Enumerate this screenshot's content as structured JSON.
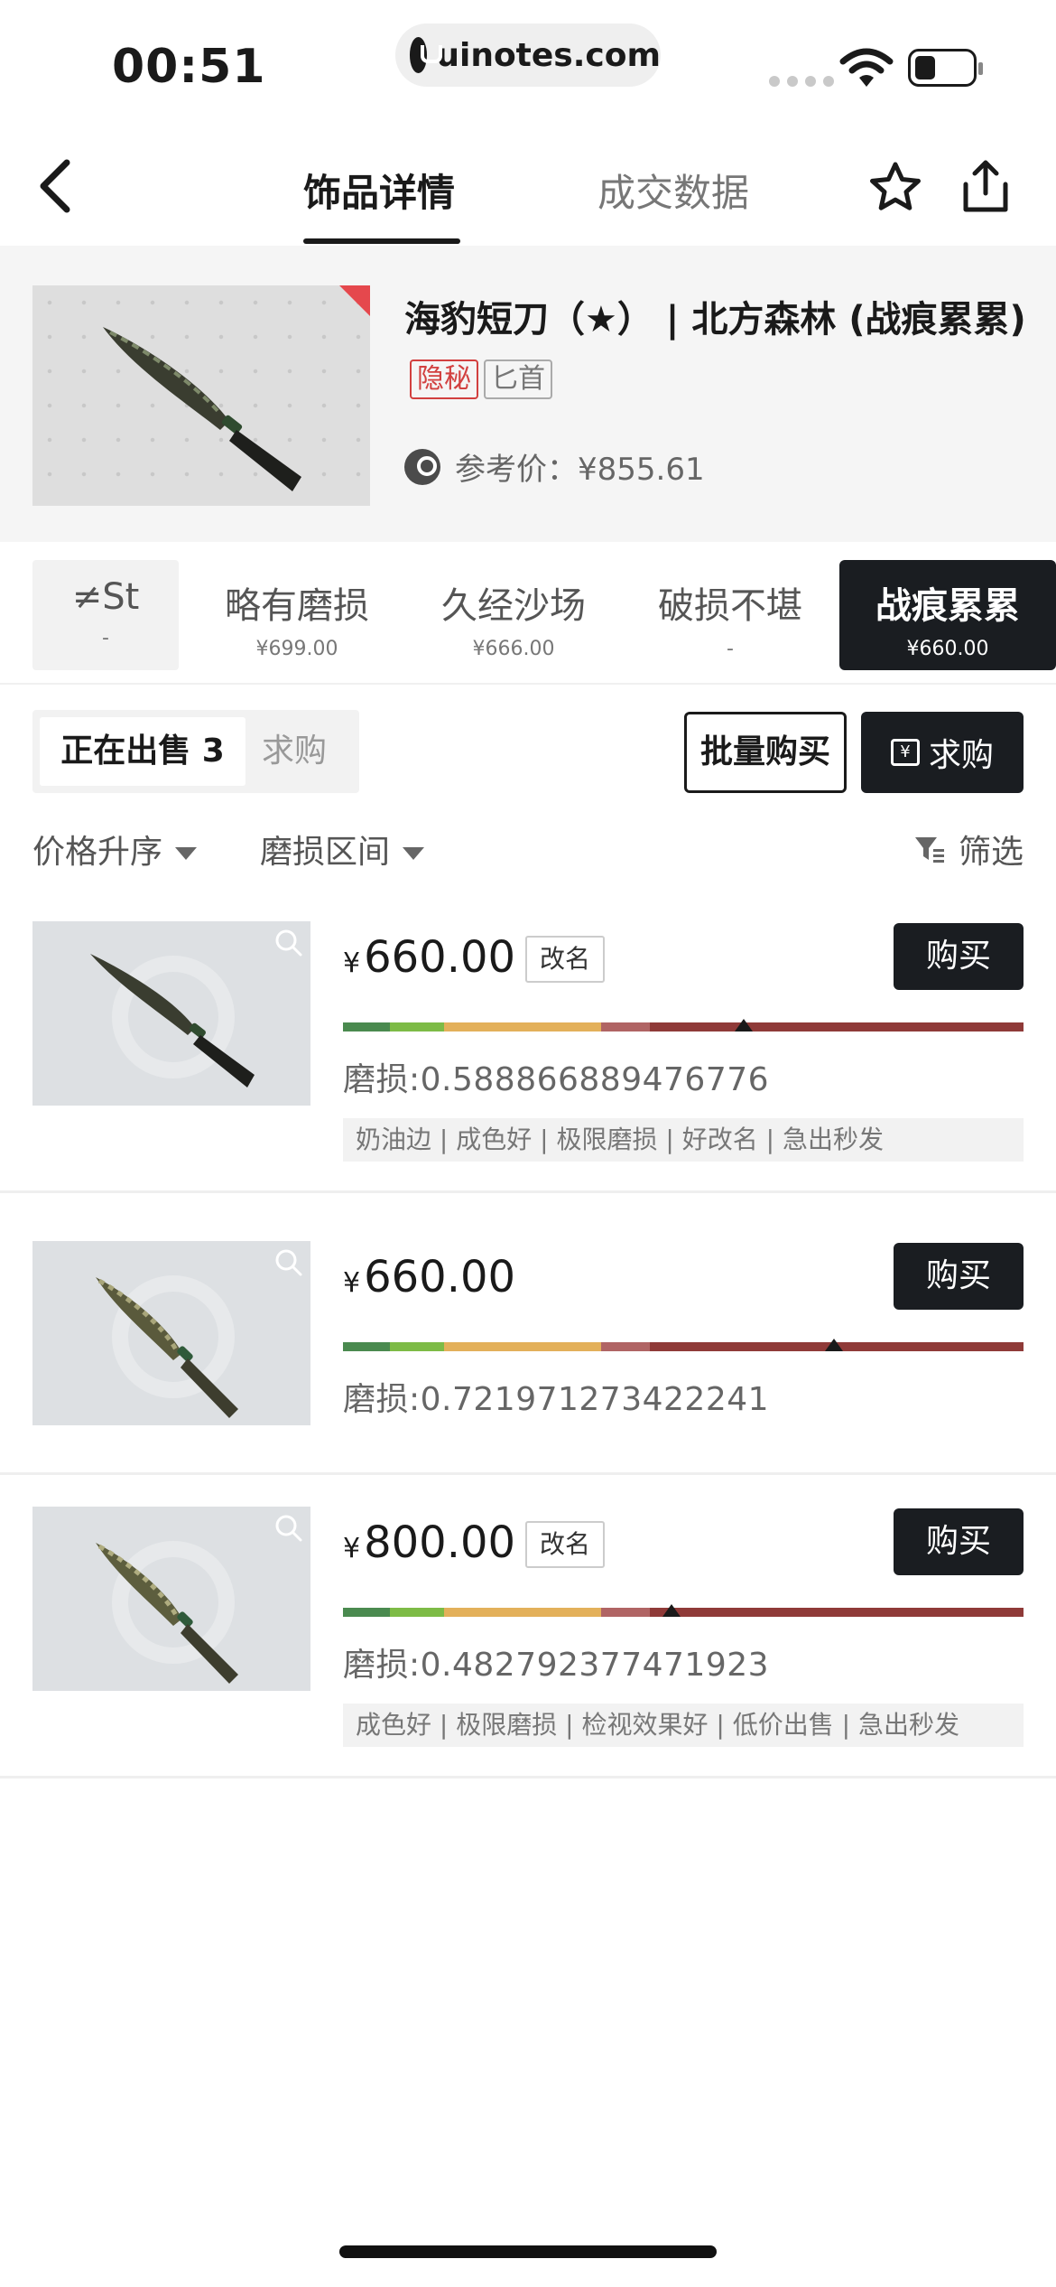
{
  "status": {
    "time": "00:51",
    "url": "uinotes.com"
  },
  "nav": {
    "tab_detail": "饰品详情",
    "tab_trade": "成交数据"
  },
  "item": {
    "title": "海豹短刀（★） | 北方森林 (战痕累累)",
    "tag_rarity": "隐秘",
    "tag_type": "匕首",
    "ref_price": "参考价：¥855.61"
  },
  "wears": [
    {
      "name": "≠St",
      "price": "-"
    },
    {
      "name": "略有磨损",
      "price": "¥699.00"
    },
    {
      "name": "久经沙场",
      "price": "¥666.00"
    },
    {
      "name": "破损不堪",
      "price": "-"
    },
    {
      "name": "战痕累累",
      "price": "¥660.00"
    }
  ],
  "selling": {
    "on_sale": "正在出售 3",
    "wanted": "求购",
    "batch_buy": "批量购买",
    "seek_buy": "求购"
  },
  "filters": {
    "sort": "价格升序",
    "wear_range": "磨损区间",
    "filter": "筛选"
  },
  "listings": [
    {
      "price": "660.00",
      "rename": "改名",
      "wear": "磨损:0.588866889476776",
      "wear_value": 0.588866889476776,
      "tags": "奶油边 | 成色好 | 极限磨损 | 好改名 | 急出秒发",
      "buy": "购买"
    },
    {
      "price": "660.00",
      "rename": "",
      "wear": "磨损:0.721971273422241",
      "wear_value": 0.721971273422241,
      "tags": "",
      "buy": "购买"
    },
    {
      "price": "800.00",
      "rename": "改名",
      "wear": "磨损:0.482792377471923",
      "wear_value": 0.482792377471923,
      "tags": "成色好 | 极限磨损 | 检视效果好 | 低价出售 | 急出秒发",
      "buy": "购买"
    }
  ],
  "colors": {
    "dark_button": "#1a1d21",
    "rarity_red": "#d2403f",
    "wear_fn": "#4a8a4f",
    "wear_mw": "#7dbb46",
    "wear_ft": "#e3b05a",
    "wear_ww": "#b06464",
    "wear_bs": "#8f3a38"
  }
}
